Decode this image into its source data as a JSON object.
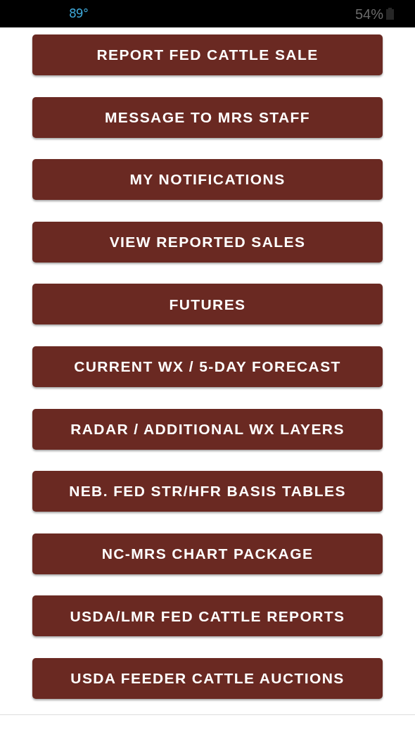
{
  "status_bar": {
    "temperature": "89°",
    "battery": "54%"
  },
  "buttons": [
    {
      "label": "REPORT FED CATTLE SALE"
    },
    {
      "label": "MESSAGE TO MRS STAFF"
    },
    {
      "label": "MY NOTIFICATIONS"
    },
    {
      "label": "VIEW REPORTED SALES"
    },
    {
      "label": "FUTURES"
    },
    {
      "label": "CURRENT WX / 5-DAY FORECAST"
    },
    {
      "label": "RADAR / ADDITIONAL WX LAYERS"
    },
    {
      "label": "NEB. FED STR/HFR BASIS TABLES"
    },
    {
      "label": "NC-MRS CHART PACKAGE"
    },
    {
      "label": "USDA/LMR FED CATTLE REPORTS"
    },
    {
      "label": "USDA FEEDER CATTLE AUCTIONS"
    }
  ]
}
